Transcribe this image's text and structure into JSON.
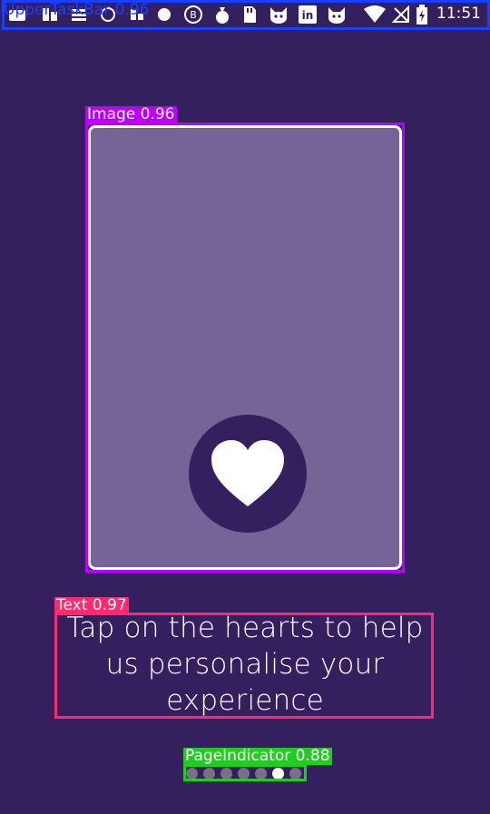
{
  "status_bar": {
    "time": "11:51",
    "detection_label": "UpperTaskBar 0.96",
    "icons": [
      "notification-icon",
      "notification-icon",
      "notification-icon",
      "notification-icon",
      "notification-icon",
      "notification-icon",
      "bitcoin-icon",
      "money-bag-icon",
      "sd-card-icon",
      "cat-icon",
      "linkedin-icon",
      "cat-icon",
      "wifi-icon",
      "no-signal-icon",
      "battery-charging-icon"
    ]
  },
  "image_card": {
    "detection_label": "Image 0.96",
    "icon": "heart-icon"
  },
  "prompt": {
    "detection_label": "Text 0.97",
    "text": "Tap on the hearts to help us personalise your experience"
  },
  "page_indicator": {
    "detection_label": "PageIndicator 0.88",
    "count": 7,
    "active_index": 5
  },
  "colors": {
    "background": "#35205f",
    "card": "#756596",
    "taskbar_box": "#1a3fff",
    "image_box": "#bb00ff",
    "text_box": "#ff2a6d",
    "indicator_box": "#22cc22"
  }
}
